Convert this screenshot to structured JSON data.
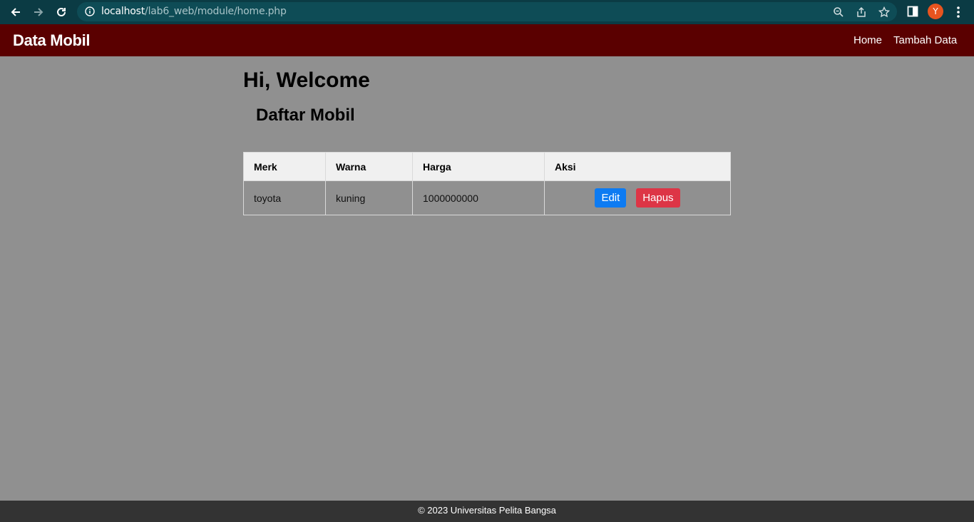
{
  "browser": {
    "url_host": "localhost",
    "url_path": "/lab6_web/module/home.php",
    "profile_initial": "Y"
  },
  "navbar": {
    "brand": "Data Mobil",
    "links": [
      "Home",
      "Tambah Data"
    ]
  },
  "main": {
    "welcome": "Hi, Welcome",
    "title": "Daftar Mobil",
    "table": {
      "headers": [
        "Merk",
        "Warna",
        "Harga",
        "Aksi"
      ],
      "rows": [
        {
          "merk": "toyota",
          "warna": "kuning",
          "harga": "1000000000",
          "edit_label": "Edit",
          "hapus_label": "Hapus"
        }
      ]
    }
  },
  "footer": {
    "text": "© 2023 Universitas Pelita Bangsa"
  },
  "colors": {
    "browser_bar": "#0b3b44",
    "navbar": "#5a0000",
    "page_bg": "#909090",
    "edit_button": "#0d7bf2",
    "hapus_button": "#dd3546",
    "footer": "#333333"
  }
}
